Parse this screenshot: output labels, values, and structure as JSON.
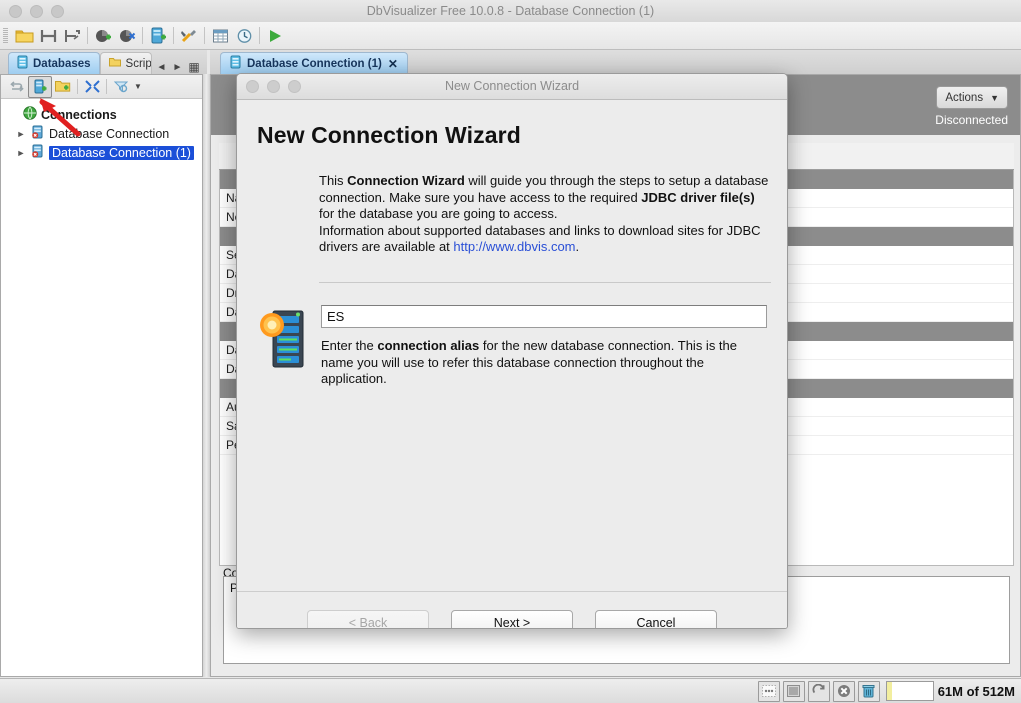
{
  "window": {
    "title": "DbVisualizer Free 10.0.8 - Database Connection (1)"
  },
  "toolbar": {
    "icons": [
      {
        "name": "open-folder-icon",
        "label": "Open File"
      },
      {
        "name": "save-icon",
        "label": "Save"
      },
      {
        "name": "save-as-icon",
        "label": "Save As"
      },
      {
        "name": "connect-icon",
        "label": "Connect"
      },
      {
        "name": "disconnect-icon",
        "label": "Disconnect"
      },
      {
        "name": "new-database-connection-icon",
        "label": "Create Database Connection"
      },
      {
        "name": "tools-icon",
        "label": "Tools"
      },
      {
        "name": "grid-icon",
        "label": "SQL Commander"
      },
      {
        "name": "monitor-icon",
        "label": "Monitor"
      },
      {
        "name": "execute-icon",
        "label": "Execute"
      }
    ]
  },
  "left_panel": {
    "tabs": [
      {
        "label": "Databases",
        "icon": "database-icon",
        "active": true
      },
      {
        "label": "Scrip",
        "icon": "folder-icon",
        "active": false
      }
    ],
    "tab_nav": [
      "prev-arrow-icon",
      "next-arrow-icon",
      "tab-list-icon"
    ],
    "toolbar_buttons": [
      {
        "name": "reconnect-icon",
        "label": "Reconnect",
        "selected": false
      },
      {
        "name": "create-database-connection-icon",
        "label": "Create Database Connection",
        "selected": true
      },
      {
        "name": "new-folder-icon",
        "label": "New Folder",
        "selected": false
      },
      {
        "name": "collapse-all-icon",
        "label": "Collapse All",
        "selected": false
      },
      {
        "name": "filter-icon",
        "label": "Filter",
        "selected": false
      }
    ],
    "tree": {
      "root": {
        "label": "Connections",
        "icon": "globe-icon"
      },
      "items": [
        {
          "label": "Database Connection",
          "icon": "database-disconnected-icon",
          "selected": false
        },
        {
          "label": "Database Connection (1)",
          "icon": "database-disconnected-icon",
          "selected": true
        }
      ]
    }
  },
  "editor": {
    "tab": {
      "label": "Database Connection (1)",
      "icon": "database-icon",
      "close": "✕"
    },
    "actions_button": {
      "label": "Actions",
      "caret": "▼"
    },
    "status": "Disconnected",
    "form_labels": [
      "Na:",
      "Ne",
      "Se",
      "Da",
      "Dr",
      "Da",
      "Da",
      "Da",
      "Au",
      "Sa",
      "Pe"
    ],
    "connection_message_label": "Co",
    "connection_message_text": "Pl"
  },
  "dialog": {
    "titlebar": "New Connection Wizard",
    "heading": "New Connection Wizard",
    "intro": {
      "part1": "This ",
      "bold1": "Connection Wizard",
      "part2": " will guide you through the steps to setup a database connection. Make sure you have access to the required ",
      "bold2": "JDBC driver file(s)",
      "part3": " for the database you are going to access.",
      "line2_pre": "Information about supported databases and links to download sites for JDBC drivers are available at ",
      "link": "http://www.dbvis.com",
      "line2_post": "."
    },
    "alias_input": {
      "value": "ES",
      "placeholder": ""
    },
    "alias_desc": {
      "part1": "Enter the ",
      "bold1": "connection alias",
      "part2": " for the new database connection. This is the name you will use to refer this database connection throughout the application."
    },
    "buttons": {
      "back": "< Back",
      "next": "Next >",
      "cancel": "Cancel"
    }
  },
  "statusbar": {
    "buttons": [
      {
        "name": "grid-preview-icon"
      },
      {
        "name": "log-icon"
      },
      {
        "name": "refresh-icon"
      },
      {
        "name": "stop-icon"
      },
      {
        "name": "trash-icon"
      }
    ],
    "memory": {
      "text": "61M of 512M",
      "percent": 12
    }
  },
  "colors": {
    "accent_blue": "#1b4fd8",
    "tab_blue": "#9ecdf0",
    "header_grey": "#8c8c8c",
    "link": "#2a4fd6",
    "memory_fill": "#f2ee9f",
    "annotation_red": "#e02020"
  }
}
